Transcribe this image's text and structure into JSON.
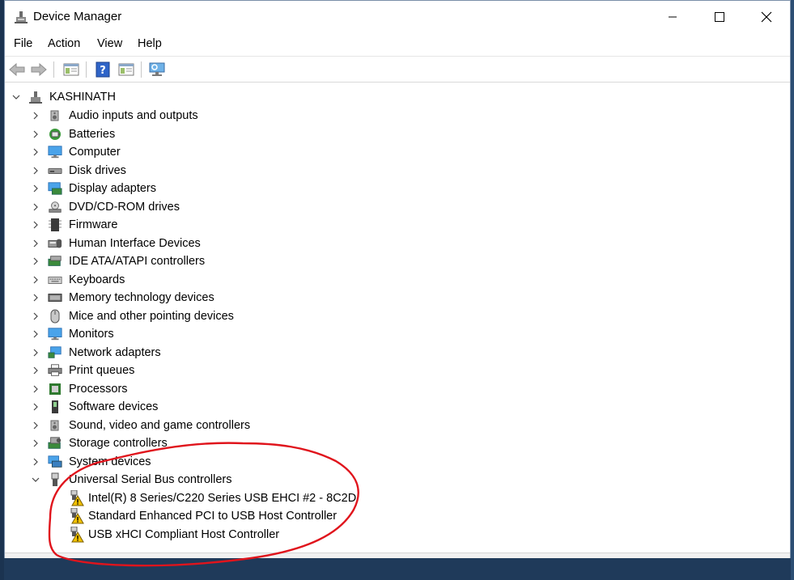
{
  "window": {
    "title": "Device Manager"
  },
  "menu": [
    "File",
    "Action",
    "View",
    "Help"
  ],
  "toolbar": {
    "buttons": [
      "back-icon",
      "forward-icon",
      "show-hide-console-tree-icon",
      "help-icon",
      "properties-icon",
      "scan-hardware-icon"
    ]
  },
  "tree": {
    "root": "KASHINATH",
    "categories": [
      {
        "label": "Audio inputs and outputs",
        "icon": "speaker-icon"
      },
      {
        "label": "Batteries",
        "icon": "battery-icon"
      },
      {
        "label": "Computer",
        "icon": "monitor-icon"
      },
      {
        "label": "Disk drives",
        "icon": "disk-drive-icon"
      },
      {
        "label": "Display adapters",
        "icon": "display-adapter-icon"
      },
      {
        "label": "DVD/CD-ROM drives",
        "icon": "dvd-drive-icon"
      },
      {
        "label": "Firmware",
        "icon": "chip-icon"
      },
      {
        "label": "Human Interface Devices",
        "icon": "hid-icon"
      },
      {
        "label": "IDE ATA/ATAPI controllers",
        "icon": "ide-controller-icon"
      },
      {
        "label": "Keyboards",
        "icon": "keyboard-icon"
      },
      {
        "label": "Memory technology devices",
        "icon": "memory-icon"
      },
      {
        "label": "Mice and other pointing devices",
        "icon": "mouse-icon"
      },
      {
        "label": "Monitors",
        "icon": "monitor-icon"
      },
      {
        "label": "Network adapters",
        "icon": "network-icon"
      },
      {
        "label": "Print queues",
        "icon": "printer-icon"
      },
      {
        "label": "Processors",
        "icon": "processor-icon"
      },
      {
        "label": "Software devices",
        "icon": "software-device-icon"
      },
      {
        "label": "Sound, video and game controllers",
        "icon": "speaker-icon"
      },
      {
        "label": "Storage controllers",
        "icon": "storage-controller-icon"
      },
      {
        "label": "System devices",
        "icon": "system-device-icon"
      },
      {
        "label": "Universal Serial Bus controllers",
        "icon": "usb-icon",
        "expanded": true
      }
    ],
    "usb_children": [
      {
        "label": "Intel(R) 8 Series/C220 Series USB EHCI #2 - 8C2D",
        "icon": "usb-warning-icon"
      },
      {
        "label": "Standard Enhanced PCI to USB Host Controller",
        "icon": "usb-warning-icon"
      },
      {
        "label": "USB xHCI Compliant Host Controller",
        "icon": "usb-warning-icon"
      }
    ]
  },
  "colors": {
    "annotation": "#e0141c",
    "warning": "#f2c200",
    "accent": "#2a72c8"
  }
}
